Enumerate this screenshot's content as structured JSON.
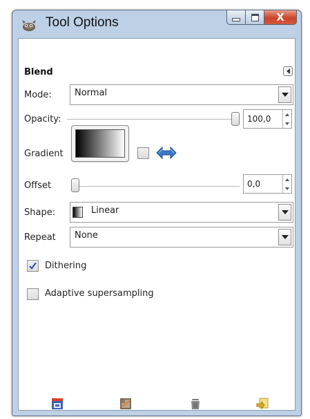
{
  "window": {
    "title": "Tool Options",
    "controls": {
      "minimize": "minimize",
      "maximize": "maximize",
      "close": "X"
    }
  },
  "blend": {
    "section_title": "Blend",
    "mode": {
      "label": "Mode:",
      "value": "Normal"
    },
    "opacity": {
      "label": "Opacity:",
      "value": "100,0",
      "slider_fraction": 1.0
    },
    "gradient": {
      "label": "Gradient",
      "reverse_checked": false
    },
    "offset": {
      "label": "Offset",
      "value": "0,0",
      "slider_fraction": 0.0
    },
    "shape": {
      "label": "Shape:",
      "value": "Linear"
    },
    "repeat": {
      "label": "Repeat",
      "value": "None"
    },
    "dithering": {
      "label": "Dithering",
      "checked": true
    },
    "adaptive": {
      "label": "Adaptive supersampling",
      "checked": false
    }
  },
  "footer": {
    "icons": [
      "save-options-icon",
      "restore-options-icon",
      "delete-options-icon",
      "reset-options-icon"
    ]
  },
  "colors": {
    "window_frame": "#bdd0e6",
    "close_button": "#c9452b",
    "panel_background": "#ffffff",
    "swap_icon": "#3a78c8"
  }
}
